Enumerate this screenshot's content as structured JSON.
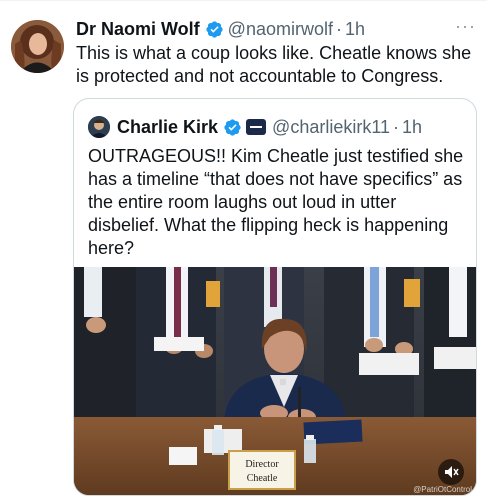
{
  "tweet": {
    "author": {
      "name": "Dr Naomi Wolf",
      "handle": "@naomirwolf",
      "separator": "·",
      "time": "1h"
    },
    "more_label": "···",
    "text": "This is what a coup looks like. Cheatle knows she is protected and not accountable to Congress."
  },
  "quote": {
    "author": {
      "name": "Charlie Kirk",
      "handle": "@charliekirk11",
      "separator": "·",
      "time": "1h"
    },
    "text": "OUTRAGEOUS!! Kim Cheatle just testified she has a timeline “that does not have specifics” as the entire room laughs out loud in utter disbelief. What the flipping heck is happening here?",
    "media": {
      "nameplate_line1": "Director",
      "nameplate_line2": "Cheatle",
      "watermark": "@PatriOtControl"
    }
  },
  "colors": {
    "verified_blue": "#1d9bf0",
    "text_primary": "#0f1419",
    "text_secondary": "#536471",
    "border": "#cfd9de"
  },
  "icons": [
    "verified-badge-icon",
    "more-icon",
    "org-badge-icon",
    "mute-icon"
  ]
}
